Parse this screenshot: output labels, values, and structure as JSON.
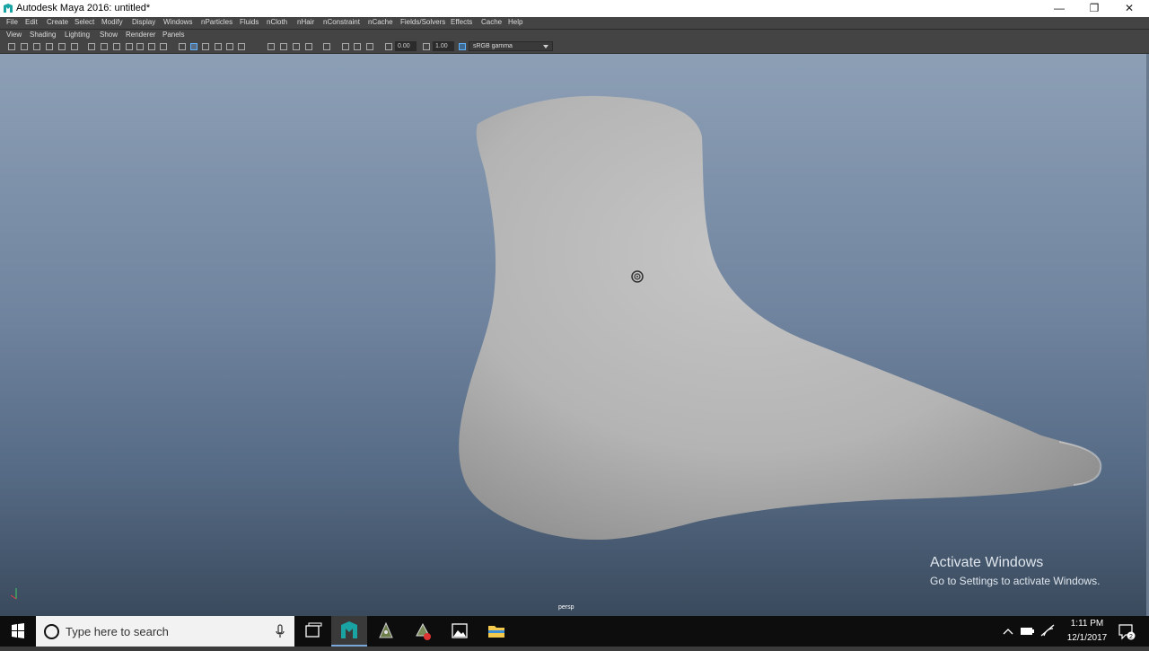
{
  "window": {
    "title": "Autodesk Maya 2016: untitled*",
    "controls": {
      "minimize": "—",
      "restore": "❐",
      "close": "✕"
    }
  },
  "menubar": [
    "File",
    "Edit",
    "Create",
    "Select",
    "Modify",
    "Display",
    "Windows",
    "nParticles",
    "Fluids",
    "nCloth",
    "nHair",
    "nConstraint",
    "nCache",
    "Fields/Solvers",
    "Effects",
    "Cache",
    "Help"
  ],
  "panel_menu": [
    "View",
    "Shading",
    "Lighting",
    "Show",
    "Renderer",
    "Panels"
  ],
  "toolbar": {
    "exposure": "0.00",
    "gamma": "1.00",
    "color_space": "sRGB gamma"
  },
  "viewport": {
    "camera": "persp",
    "watermark_title": "Activate Windows",
    "watermark_subtitle": "Go to Settings to activate Windows.",
    "colors": {
      "top": "#8c9fb5",
      "bottom": "#3a4a5d",
      "mesh": "#bdbdbd"
    }
  },
  "taskbar": {
    "search_placeholder": "Type here to search",
    "time": "1:11 PM",
    "date": "12/1/2017",
    "notification_count": "2"
  }
}
